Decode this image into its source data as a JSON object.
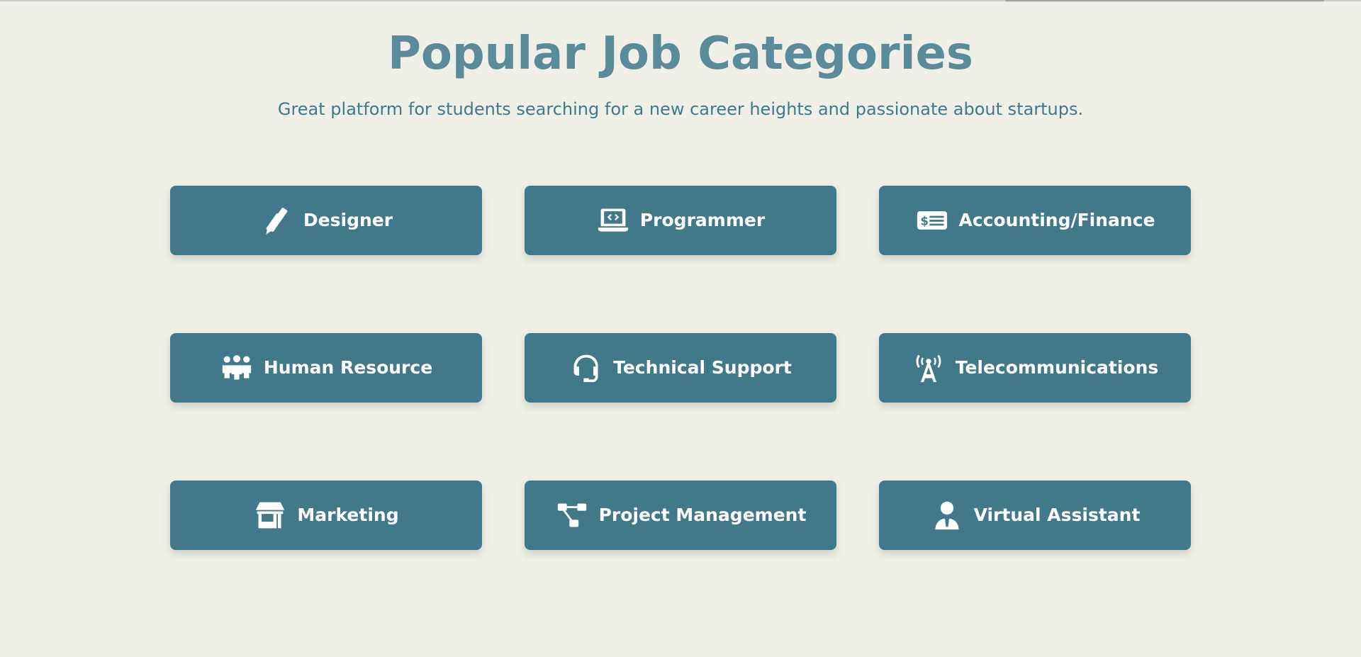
{
  "section": {
    "title": "Popular Job Categories",
    "subtitle": "Great platform for students searching for a new career heights and passionate about startups."
  },
  "categories": [
    {
      "label": "Designer",
      "icon": "pencil-ruler-icon"
    },
    {
      "label": "Programmer",
      "icon": "laptop-code-icon"
    },
    {
      "label": "Accounting/Finance",
      "icon": "money-check-icon"
    },
    {
      "label": "Human Resource",
      "icon": "people-group-icon"
    },
    {
      "label": "Technical Support",
      "icon": "headset-icon"
    },
    {
      "label": "Telecommunications",
      "icon": "tower-broadcast-icon"
    },
    {
      "label": "Marketing",
      "icon": "shop-icon"
    },
    {
      "label": "Project Management",
      "icon": "diagram-project-icon"
    },
    {
      "label": "Virtual Assistant",
      "icon": "user-tie-icon"
    }
  ],
  "colors": {
    "background": "#f0efe7",
    "title": "#5a8b99",
    "subtitle": "#3f7a8b",
    "card": "#41798b",
    "card_text": "#ffffff"
  }
}
